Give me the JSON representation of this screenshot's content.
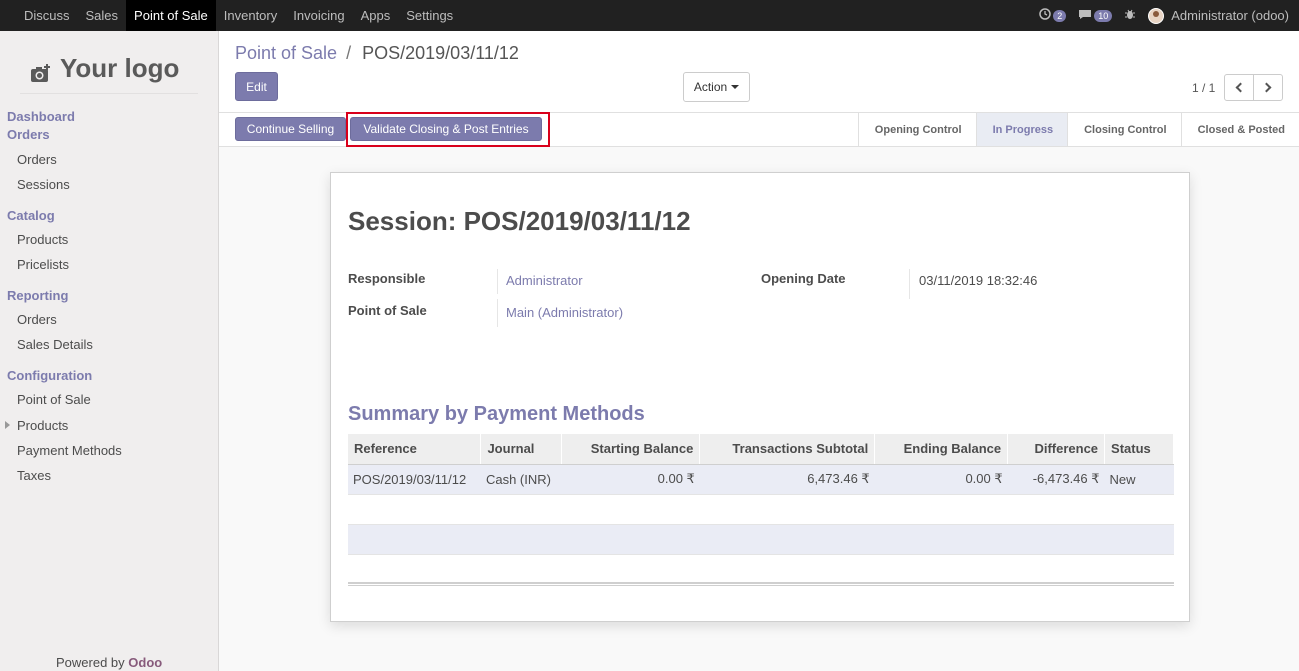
{
  "topnav": {
    "items": [
      "Discuss",
      "Sales",
      "Point of Sale",
      "Inventory",
      "Invoicing",
      "Apps",
      "Settings"
    ],
    "active_index": 2,
    "chat_count": "2",
    "messages_count": "10",
    "user": "Administrator (odoo)"
  },
  "sidebar": {
    "logo_text": "Your logo",
    "sections": {
      "dashboard": "Dashboard",
      "orders": "Orders",
      "catalog": "Catalog",
      "reporting": "Reporting",
      "configuration": "Configuration"
    },
    "orders_items": [
      "Orders",
      "Sessions"
    ],
    "catalog_items": [
      "Products",
      "Pricelists"
    ],
    "reporting_items": [
      "Orders",
      "Sales Details"
    ],
    "configuration_items": [
      "Point of Sale",
      "Products",
      "Payment Methods",
      "Taxes"
    ],
    "powered_prefix": "Powered by",
    "powered_brand": "Odoo"
  },
  "control": {
    "breadcrumb_parent": "Point of Sale",
    "breadcrumb_sep": "/",
    "breadcrumb_current": "POS/2019/03/11/12",
    "edit_label": "Edit",
    "action_label": "Action",
    "pager": "1 / 1"
  },
  "statusbar": {
    "continue_label": "Continue Selling",
    "validate_label": "Validate Closing & Post Entries",
    "stages": [
      "Opening Control",
      "In Progress",
      "Closing Control",
      "Closed & Posted"
    ],
    "active_stage": 1
  },
  "sheet": {
    "title": "Session: POS/2019/03/11/12",
    "responsible_label": "Responsible",
    "responsible_value": "Administrator",
    "pos_label": "Point of Sale",
    "pos_value": "Main (Administrator)",
    "opening_label": "Opening Date",
    "opening_value": "03/11/2019 18:32:46",
    "summary_title": "Summary by Payment Methods",
    "columns": [
      "Reference",
      "Journal",
      "Starting Balance",
      "Transactions Subtotal",
      "Ending Balance",
      "Difference",
      "Status"
    ],
    "rows": [
      [
        "POS/2019/03/11/12",
        "Cash (INR)",
        "0.00 ₹",
        "6,473.46 ₹",
        "0.00 ₹",
        "-6,473.46 ₹",
        "New"
      ]
    ]
  },
  "colors": {
    "accent": "#7c7bad",
    "navbar": "#212121",
    "highlight_border": "#d9001b"
  }
}
